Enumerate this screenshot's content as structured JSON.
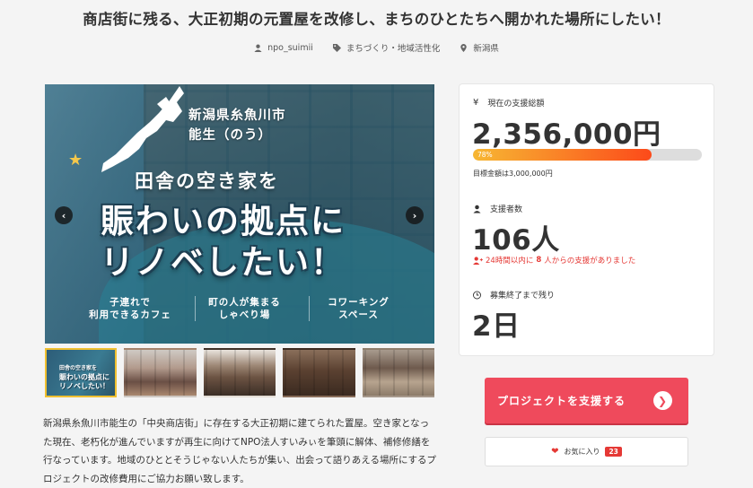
{
  "project": {
    "title": "商店街に残る、大正初期の元置屋を改修し、まちのひとたちへ開かれた場所にしたい！",
    "owner": "npo_suimii",
    "category": "まちづくり・地域活性化",
    "location": "新潟県"
  },
  "hero": {
    "place_line1": "新潟県糸魚川市",
    "place_line2": "能生（のう）",
    "headline1": "田舎の空き家を",
    "headline2a": "賑わいの拠点に",
    "headline2b": "リノベしたい！",
    "features": [
      {
        "line1": "子連れで",
        "line2": "利用できるカフェ"
      },
      {
        "line1": "町の人が集まる",
        "line2": "しゃべり場"
      },
      {
        "line1": "コワーキング",
        "line2": "スペース"
      }
    ],
    "thumb1_line1": "田舎の空き家を",
    "thumb1_line2": "賑わいの拠点に",
    "thumb1_line3": "リノベしたい！"
  },
  "description": "新潟県糸魚川市能生の「中央商店街」に存在する大正初期に建てられた置屋。空き家となった現在、老朽化が進んでいますが再生に向けてNPO法人すいみぃを筆頭に解体、補修修繕を行なっています。地域のひととそうじゃない人たちが集い、出会って語りあえる場所にするプロジェクトの改修費用にご協力お願い致します。",
  "stats": {
    "amount_label": "現在の支援総額",
    "amount_value": "2,356,000円",
    "progress_percent": 78,
    "progress_label": "78%",
    "goal_text": "目標金額は3,000,000円",
    "supporters_label": "支援者数",
    "supporters_value": "106人",
    "recent_prefix": "24時間以内に",
    "recent_count": "8",
    "recent_suffix": "人からの支援がありました",
    "remaining_label": "募集終了まで残り",
    "remaining_value": "2日"
  },
  "actions": {
    "support_label": "プロジェクトを支援する",
    "favorite_label": "お気に入り",
    "favorite_count": "23"
  },
  "colors": {
    "accent": "#ef4a5c",
    "progress_start": "#f7b733",
    "progress_end": "#fc4a1a",
    "alert": "#e53935",
    "active_thumb": "#f0c030"
  }
}
